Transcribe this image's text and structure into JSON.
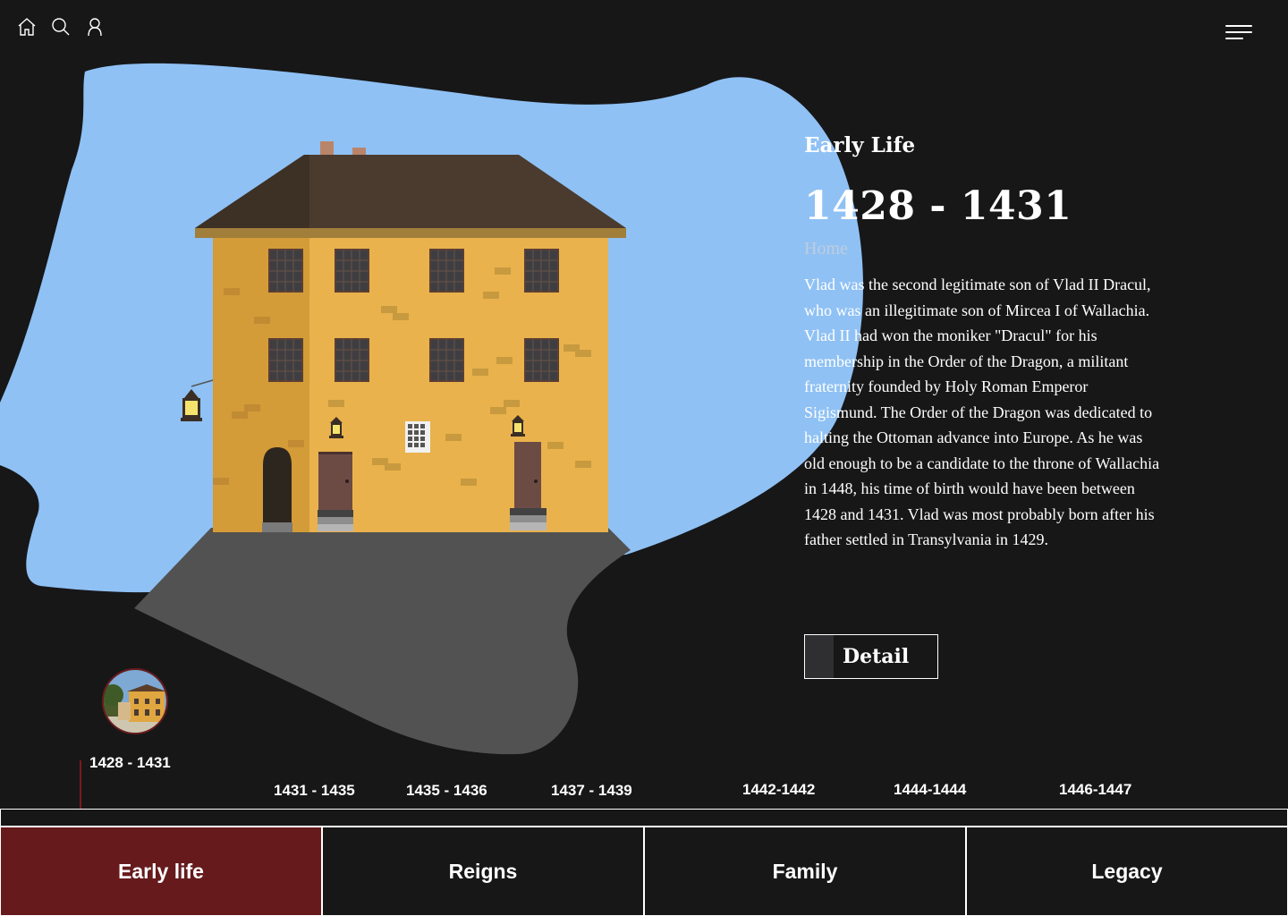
{
  "colors": {
    "background": "#171718",
    "sky": "#8fc1f4",
    "accent": "#661a1c",
    "road": "#525252",
    "wall": "#e9b24c",
    "roof": "#4a3b2e"
  },
  "nav": {
    "icons": [
      "home-icon",
      "search-icon",
      "user-icon"
    ],
    "menu_icon": "hamburger-menu-icon"
  },
  "content": {
    "section_title": "Early Life",
    "year_range": "1428 - 1431",
    "breadcrumb": "Home",
    "bio": "Vlad was the second legitimate son of Vlad II Dracul, who was an illegitimate son of Mircea I of Wallachia. Vlad II had won the moniker \"Dracul\" for his membership in the Order of the Dragon, a militant fraternity founded by Holy Roman Emperor Sigismund. The Order of the Dragon was dedicated to halting the Ottoman advance into Europe. As he was old enough to be a candidate to the throne of Wallachia in 1448, his time of birth would have been between 1428 and 1431. Vlad was most probably born after his father settled in Transylvania in 1429.",
    "detail_button": "Detail"
  },
  "timeline": {
    "active": "1428 - 1431",
    "periods": [
      "1431 - 1435",
      "1435 - 1436",
      "1437 - 1439",
      "1442-1442",
      "1444-1444",
      "1446-1447"
    ]
  },
  "tabs": [
    {
      "label": "Early life",
      "active": true
    },
    {
      "label": "Reigns",
      "active": false
    },
    {
      "label": "Family",
      "active": false
    },
    {
      "label": "Legacy",
      "active": false
    }
  ]
}
